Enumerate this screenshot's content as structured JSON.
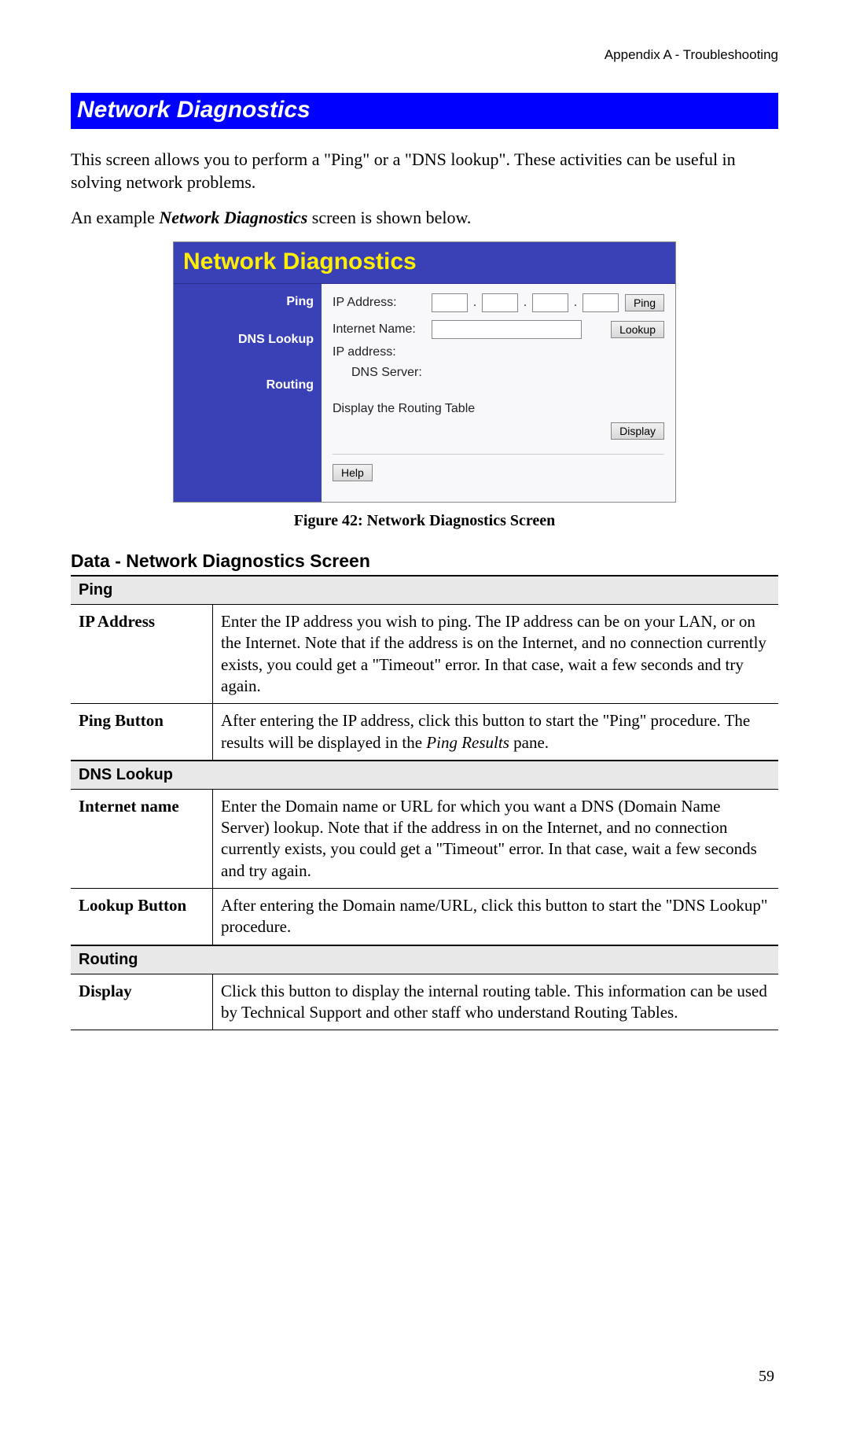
{
  "header": {
    "breadcrumb": "Appendix A - Troubleshooting"
  },
  "section": {
    "banner": "Network Diagnostics"
  },
  "intro": {
    "p1": "This screen allows you to perform a \"Ping\" or a \"DNS lookup\". These activities can be useful in solving network problems.",
    "p2_pre": "An example ",
    "p2_em": "Network Diagnostics",
    "p2_post": " screen is shown below."
  },
  "figure": {
    "title": "Network Diagnostics",
    "side": {
      "ping": "Ping",
      "dns": "DNS Lookup",
      "routing": "Routing"
    },
    "ping": {
      "label": "IP Address:",
      "button": "Ping"
    },
    "dns": {
      "label": "Internet Name:",
      "ip_label": "IP address:",
      "server_label": "DNS Server:",
      "button": "Lookup"
    },
    "routing": {
      "label": "Display the Routing Table",
      "button": "Display"
    },
    "help": "Help",
    "caption": "Figure 42: Network Diagnostics Screen"
  },
  "datatable": {
    "heading": "Data - Network Diagnostics Screen",
    "sections": [
      {
        "title": "Ping",
        "rows": [
          {
            "k": "IP Address",
            "v": "Enter the IP address you wish to ping. The IP address can be on your LAN, or on the Internet. Note that if the address is on the Internet, and no connection currently exists, you could get a \"Timeout\" error. In that case, wait a few seconds and try again."
          },
          {
            "k": "Ping Button",
            "v_pre": "After entering the IP address, click this button to start the \"Ping\" procedure. The results will be displayed in the ",
            "v_em": "Ping Results",
            "v_post": " pane."
          }
        ]
      },
      {
        "title": "DNS Lookup",
        "rows": [
          {
            "k": "Internet name",
            "v": "Enter the Domain name or URL for which you want a DNS (Domain Name Server) lookup. Note that if the address in on the Internet, and no connection currently exists, you could get a \"Timeout\" error. In that case, wait a few seconds and try again."
          },
          {
            "k": "Lookup Button",
            "v": "After entering the Domain name/URL, click this button to start the \"DNS Lookup\" procedure."
          }
        ]
      },
      {
        "title": "Routing",
        "rows": [
          {
            "k": "Display",
            "v": "Click this button to display the internal routing table. This information can be used by Technical Support and other staff who understand Routing Tables."
          }
        ]
      }
    ]
  },
  "footer": {
    "page": "59"
  }
}
